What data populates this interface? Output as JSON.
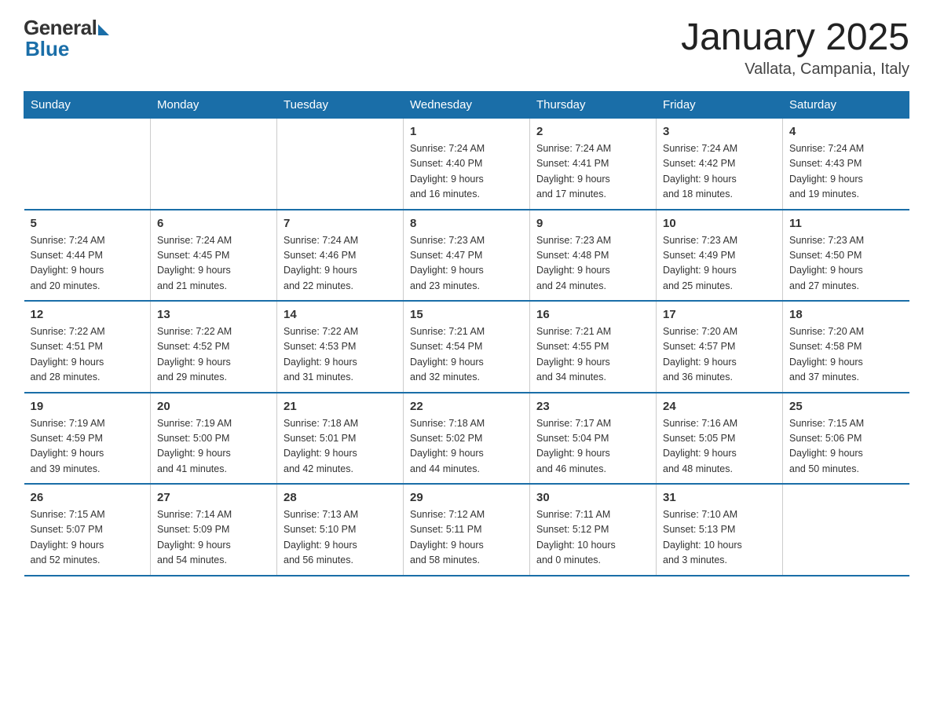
{
  "header": {
    "logo_general": "General",
    "logo_blue": "Blue",
    "month_title": "January 2025",
    "location": "Vallata, Campania, Italy"
  },
  "days_of_week": [
    "Sunday",
    "Monday",
    "Tuesday",
    "Wednesday",
    "Thursday",
    "Friday",
    "Saturday"
  ],
  "weeks": [
    [
      {
        "day": "",
        "info": ""
      },
      {
        "day": "",
        "info": ""
      },
      {
        "day": "",
        "info": ""
      },
      {
        "day": "1",
        "info": "Sunrise: 7:24 AM\nSunset: 4:40 PM\nDaylight: 9 hours\nand 16 minutes."
      },
      {
        "day": "2",
        "info": "Sunrise: 7:24 AM\nSunset: 4:41 PM\nDaylight: 9 hours\nand 17 minutes."
      },
      {
        "day": "3",
        "info": "Sunrise: 7:24 AM\nSunset: 4:42 PM\nDaylight: 9 hours\nand 18 minutes."
      },
      {
        "day": "4",
        "info": "Sunrise: 7:24 AM\nSunset: 4:43 PM\nDaylight: 9 hours\nand 19 minutes."
      }
    ],
    [
      {
        "day": "5",
        "info": "Sunrise: 7:24 AM\nSunset: 4:44 PM\nDaylight: 9 hours\nand 20 minutes."
      },
      {
        "day": "6",
        "info": "Sunrise: 7:24 AM\nSunset: 4:45 PM\nDaylight: 9 hours\nand 21 minutes."
      },
      {
        "day": "7",
        "info": "Sunrise: 7:24 AM\nSunset: 4:46 PM\nDaylight: 9 hours\nand 22 minutes."
      },
      {
        "day": "8",
        "info": "Sunrise: 7:23 AM\nSunset: 4:47 PM\nDaylight: 9 hours\nand 23 minutes."
      },
      {
        "day": "9",
        "info": "Sunrise: 7:23 AM\nSunset: 4:48 PM\nDaylight: 9 hours\nand 24 minutes."
      },
      {
        "day": "10",
        "info": "Sunrise: 7:23 AM\nSunset: 4:49 PM\nDaylight: 9 hours\nand 25 minutes."
      },
      {
        "day": "11",
        "info": "Sunrise: 7:23 AM\nSunset: 4:50 PM\nDaylight: 9 hours\nand 27 minutes."
      }
    ],
    [
      {
        "day": "12",
        "info": "Sunrise: 7:22 AM\nSunset: 4:51 PM\nDaylight: 9 hours\nand 28 minutes."
      },
      {
        "day": "13",
        "info": "Sunrise: 7:22 AM\nSunset: 4:52 PM\nDaylight: 9 hours\nand 29 minutes."
      },
      {
        "day": "14",
        "info": "Sunrise: 7:22 AM\nSunset: 4:53 PM\nDaylight: 9 hours\nand 31 minutes."
      },
      {
        "day": "15",
        "info": "Sunrise: 7:21 AM\nSunset: 4:54 PM\nDaylight: 9 hours\nand 32 minutes."
      },
      {
        "day": "16",
        "info": "Sunrise: 7:21 AM\nSunset: 4:55 PM\nDaylight: 9 hours\nand 34 minutes."
      },
      {
        "day": "17",
        "info": "Sunrise: 7:20 AM\nSunset: 4:57 PM\nDaylight: 9 hours\nand 36 minutes."
      },
      {
        "day": "18",
        "info": "Sunrise: 7:20 AM\nSunset: 4:58 PM\nDaylight: 9 hours\nand 37 minutes."
      }
    ],
    [
      {
        "day": "19",
        "info": "Sunrise: 7:19 AM\nSunset: 4:59 PM\nDaylight: 9 hours\nand 39 minutes."
      },
      {
        "day": "20",
        "info": "Sunrise: 7:19 AM\nSunset: 5:00 PM\nDaylight: 9 hours\nand 41 minutes."
      },
      {
        "day": "21",
        "info": "Sunrise: 7:18 AM\nSunset: 5:01 PM\nDaylight: 9 hours\nand 42 minutes."
      },
      {
        "day": "22",
        "info": "Sunrise: 7:18 AM\nSunset: 5:02 PM\nDaylight: 9 hours\nand 44 minutes."
      },
      {
        "day": "23",
        "info": "Sunrise: 7:17 AM\nSunset: 5:04 PM\nDaylight: 9 hours\nand 46 minutes."
      },
      {
        "day": "24",
        "info": "Sunrise: 7:16 AM\nSunset: 5:05 PM\nDaylight: 9 hours\nand 48 minutes."
      },
      {
        "day": "25",
        "info": "Sunrise: 7:15 AM\nSunset: 5:06 PM\nDaylight: 9 hours\nand 50 minutes."
      }
    ],
    [
      {
        "day": "26",
        "info": "Sunrise: 7:15 AM\nSunset: 5:07 PM\nDaylight: 9 hours\nand 52 minutes."
      },
      {
        "day": "27",
        "info": "Sunrise: 7:14 AM\nSunset: 5:09 PM\nDaylight: 9 hours\nand 54 minutes."
      },
      {
        "day": "28",
        "info": "Sunrise: 7:13 AM\nSunset: 5:10 PM\nDaylight: 9 hours\nand 56 minutes."
      },
      {
        "day": "29",
        "info": "Sunrise: 7:12 AM\nSunset: 5:11 PM\nDaylight: 9 hours\nand 58 minutes."
      },
      {
        "day": "30",
        "info": "Sunrise: 7:11 AM\nSunset: 5:12 PM\nDaylight: 10 hours\nand 0 minutes."
      },
      {
        "day": "31",
        "info": "Sunrise: 7:10 AM\nSunset: 5:13 PM\nDaylight: 10 hours\nand 3 minutes."
      },
      {
        "day": "",
        "info": ""
      }
    ]
  ]
}
